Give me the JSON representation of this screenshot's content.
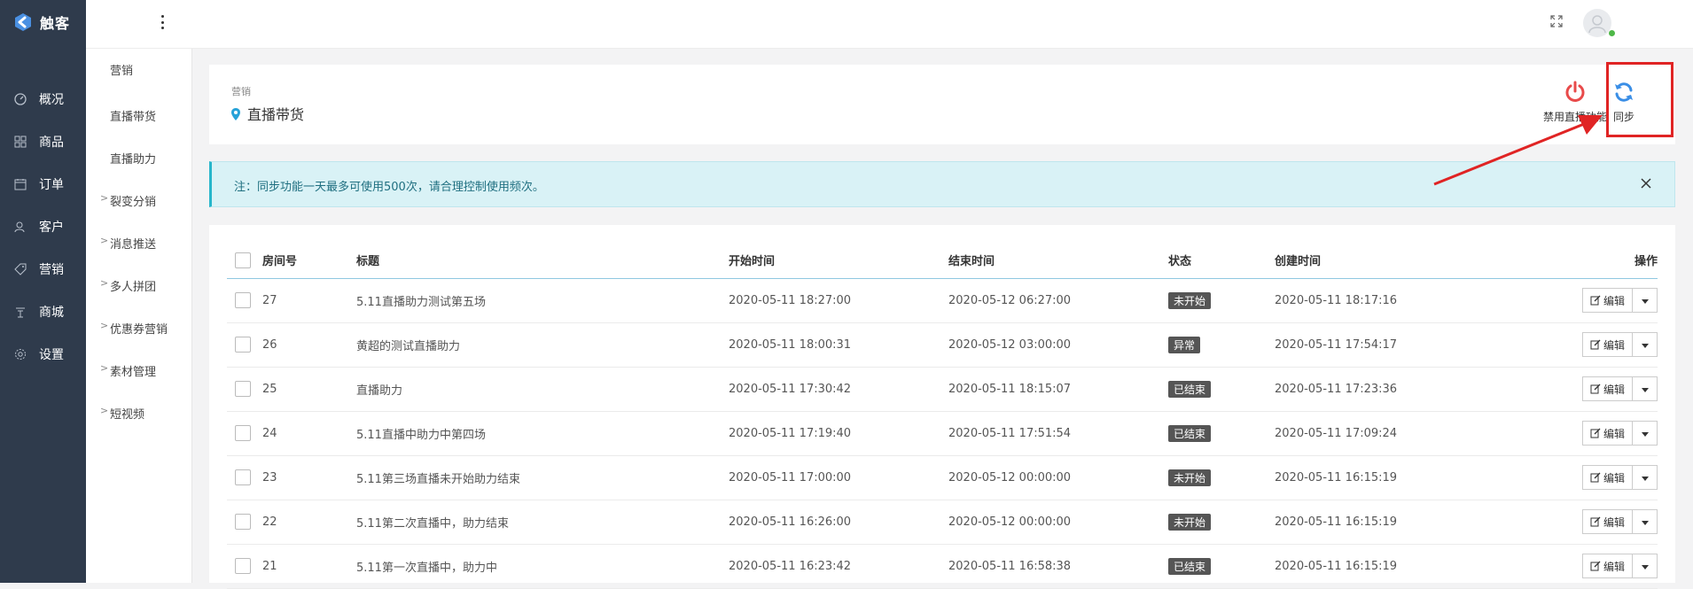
{
  "brand": {
    "name": "触客",
    "logo_color": "#4a90e2"
  },
  "sidebar": {
    "items": [
      {
        "label": "概况",
        "icon": "dashboard-icon"
      },
      {
        "label": "商品",
        "icon": "grid-icon"
      },
      {
        "label": "订单",
        "icon": "calendar-icon"
      },
      {
        "label": "客户",
        "icon": "user-icon"
      },
      {
        "label": "营销",
        "icon": "tag-icon"
      },
      {
        "label": "商城",
        "icon": "store-icon"
      },
      {
        "label": "设置",
        "icon": "gear-icon"
      }
    ]
  },
  "submenu": {
    "items": [
      {
        "label": "营销",
        "caret": ""
      },
      {
        "label": "直播带货",
        "caret": ""
      },
      {
        "label": "直播助力",
        "caret": ""
      },
      {
        "label": "裂变分销",
        "caret": ">"
      },
      {
        "label": "消息推送",
        "caret": ">"
      },
      {
        "label": "多人拼团",
        "caret": ">"
      },
      {
        "label": "优惠券营销",
        "caret": ">"
      },
      {
        "label": "素材管理",
        "caret": ">"
      },
      {
        "label": "短视频",
        "caret": ">"
      }
    ]
  },
  "breadcrumb": {
    "parent": "营销",
    "title": "直播带货"
  },
  "actions": {
    "disable_label": "禁用直播功能",
    "sync_label": "同步"
  },
  "notice": {
    "text": "注：同步功能一天最多可使用500次，请合理控制使用频次。"
  },
  "table": {
    "headers": {
      "room": "房间号",
      "title": "标题",
      "start": "开始时间",
      "end": "结束时间",
      "status": "状态",
      "created": "创建时间",
      "ops": "操作"
    },
    "edit_label": "编辑",
    "rows": [
      {
        "room": "27",
        "title": "5.11直播助力测试第五场",
        "start": "2020-05-11 18:27:00",
        "end": "2020-05-12 06:27:00",
        "status": "未开始",
        "created": "2020-05-11 18:17:16"
      },
      {
        "room": "26",
        "title": "黄超的测试直播助力",
        "start": "2020-05-11 18:00:31",
        "end": "2020-05-12 03:00:00",
        "status": "异常",
        "created": "2020-05-11 17:54:17"
      },
      {
        "room": "25",
        "title": "直播助力",
        "start": "2020-05-11 17:30:42",
        "end": "2020-05-11 18:15:07",
        "status": "已结束",
        "created": "2020-05-11 17:23:36"
      },
      {
        "room": "24",
        "title": "5.11直播中助力中第四场",
        "start": "2020-05-11 17:19:40",
        "end": "2020-05-11 17:51:54",
        "status": "已结束",
        "created": "2020-05-11 17:09:24"
      },
      {
        "room": "23",
        "title": "5.11第三场直播未开始助力结束",
        "start": "2020-05-11 17:00:00",
        "end": "2020-05-12 00:00:00",
        "status": "未开始",
        "created": "2020-05-11 16:15:19"
      },
      {
        "room": "22",
        "title": "5.11第二次直播中，助力结束",
        "start": "2020-05-11 16:26:00",
        "end": "2020-05-12 00:00:00",
        "status": "未开始",
        "created": "2020-05-11 16:15:19"
      },
      {
        "room": "21",
        "title": "5.11第一次直播中，助力中",
        "start": "2020-05-11 16:23:42",
        "end": "2020-05-11 16:58:38",
        "status": "已结束",
        "created": "2020-05-11 16:15:19"
      }
    ]
  },
  "colors": {
    "sidebar_bg": "#2f3b4c",
    "disable_icon": "#e84a4a",
    "sync_icon": "#3a8ee6",
    "annotation_red": "#e02424",
    "notice_bg": "#d9f2f6"
  }
}
